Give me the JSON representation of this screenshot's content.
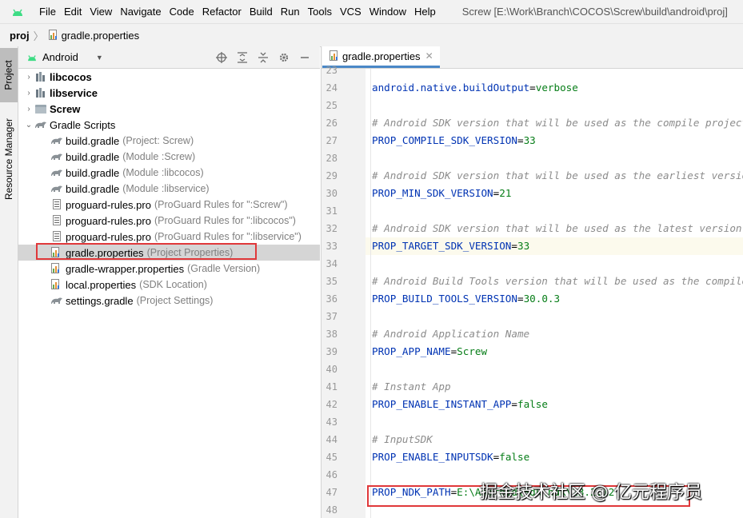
{
  "menubar": {
    "items": [
      "File",
      "Edit",
      "View",
      "Navigate",
      "Code",
      "Refactor",
      "Build",
      "Run",
      "Tools",
      "VCS",
      "Window",
      "Help"
    ],
    "title_path": "Screw [E:\\Work\\Branch\\COCOS\\Screw\\build\\android\\proj]"
  },
  "navbar": {
    "root": "proj",
    "file": "gradle.properties"
  },
  "side_stripe": {
    "project": "Project",
    "resource_manager": "Resource Manager"
  },
  "project_panel": {
    "view": "Android"
  },
  "tree": [
    {
      "label": "libcocos",
      "hint": "",
      "icon": "module-icon",
      "expandable": true,
      "expanded": false,
      "bold": true
    },
    {
      "label": "libservice",
      "hint": "",
      "icon": "module-icon",
      "expandable": true,
      "expanded": false,
      "bold": true
    },
    {
      "label": "Screw",
      "hint": "",
      "icon": "folder-icon",
      "expandable": true,
      "expanded": false,
      "bold": true
    },
    {
      "label": "Gradle Scripts",
      "hint": "",
      "icon": "gradle-icon",
      "expandable": true,
      "expanded": true,
      "bold": false
    },
    {
      "label": "build.gradle",
      "hint": "(Project: Screw)",
      "icon": "gradle-icon",
      "indent": true
    },
    {
      "label": "build.gradle",
      "hint": "(Module :Screw)",
      "icon": "gradle-icon",
      "indent": true
    },
    {
      "label": "build.gradle",
      "hint": "(Module :libcocos)",
      "icon": "gradle-icon",
      "indent": true
    },
    {
      "label": "build.gradle",
      "hint": "(Module :libservice)",
      "icon": "gradle-icon",
      "indent": true
    },
    {
      "label": "proguard-rules.pro",
      "hint": "(ProGuard Rules for \":Screw\")",
      "icon": "text-file-icon",
      "indent": true
    },
    {
      "label": "proguard-rules.pro",
      "hint": "(ProGuard Rules for \":libcocos\")",
      "icon": "text-file-icon",
      "indent": true
    },
    {
      "label": "proguard-rules.pro",
      "hint": "(ProGuard Rules for \":libservice\")",
      "icon": "text-file-icon",
      "indent": true
    },
    {
      "label": "gradle.properties",
      "hint": "(Project Properties)",
      "icon": "properties-file-icon",
      "indent": true,
      "selected": true
    },
    {
      "label": "gradle-wrapper.properties",
      "hint": "(Gradle Version)",
      "icon": "properties-file-icon",
      "indent": true
    },
    {
      "label": "local.properties",
      "hint": "(SDK Location)",
      "icon": "properties-file-icon",
      "indent": true
    },
    {
      "label": "settings.gradle",
      "hint": "(Project Settings)",
      "icon": "gradle-icon",
      "indent": true
    }
  ],
  "editor": {
    "tab_label": "gradle.properties",
    "lines": [
      {
        "num": "23",
        "key": "",
        "value": "",
        "comment": ""
      },
      {
        "num": "24",
        "key": "android.native.buildOutput",
        "value": "verbose",
        "comment": ""
      },
      {
        "num": "25",
        "key": "",
        "value": "",
        "comment": ""
      },
      {
        "num": "26",
        "key": "",
        "value": "",
        "comment": "# Android SDK version that will be used as the compile project"
      },
      {
        "num": "27",
        "key": "PROP_COMPILE_SDK_VERSION",
        "value": "33",
        "comment": ""
      },
      {
        "num": "28",
        "key": "",
        "value": "",
        "comment": ""
      },
      {
        "num": "29",
        "key": "",
        "value": "",
        "comment": "# Android SDK version that will be used as the earliest version"
      },
      {
        "num": "30",
        "key": "PROP_MIN_SDK_VERSION",
        "value": "21",
        "comment": ""
      },
      {
        "num": "31",
        "key": "",
        "value": "",
        "comment": ""
      },
      {
        "num": "32",
        "key": "",
        "value": "",
        "comment": "# Android SDK version that will be used as the latest version"
      },
      {
        "num": "33",
        "key": "PROP_TARGET_SDK_VERSION",
        "value": "33",
        "comment": "",
        "current": true
      },
      {
        "num": "34",
        "key": "",
        "value": "",
        "comment": ""
      },
      {
        "num": "35",
        "key": "",
        "value": "",
        "comment": "# Android Build Tools version that will be used as the compile"
      },
      {
        "num": "36",
        "key": "PROP_BUILD_TOOLS_VERSION",
        "value": "30.0.3",
        "comment": ""
      },
      {
        "num": "37",
        "key": "",
        "value": "",
        "comment": ""
      },
      {
        "num": "38",
        "key": "",
        "value": "",
        "comment": "# Android Application Name"
      },
      {
        "num": "39",
        "key": "PROP_APP_NAME",
        "value": "Screw",
        "comment": ""
      },
      {
        "num": "40",
        "key": "",
        "value": "",
        "comment": ""
      },
      {
        "num": "41",
        "key": "",
        "value": "",
        "comment": "# Instant App"
      },
      {
        "num": "42",
        "key": "PROP_ENABLE_INSTANT_APP",
        "value": "false",
        "comment": ""
      },
      {
        "num": "43",
        "key": "",
        "value": "",
        "comment": ""
      },
      {
        "num": "44",
        "key": "",
        "value": "",
        "comment": "# InputSDK"
      },
      {
        "num": "45",
        "key": "PROP_ENABLE_INPUTSDK",
        "value": "false",
        "comment": ""
      },
      {
        "num": "46",
        "key": "",
        "value": "",
        "comment": ""
      },
      {
        "num": "47",
        "key": "PROP_NDK_PATH",
        "value": "E:\\Android\\Sdk\\ndk\\23.2.12",
        "comment": ""
      },
      {
        "num": "48",
        "key": "",
        "value": "",
        "comment": ""
      }
    ]
  },
  "watermark": "掘金技术社区 @ 亿元程序员",
  "colors": {
    "highlight_box": "#e0383a",
    "key": "#0033b3",
    "value": "#067d17",
    "comment": "#8c8c8c",
    "tab_underline": "#4a88c7"
  }
}
